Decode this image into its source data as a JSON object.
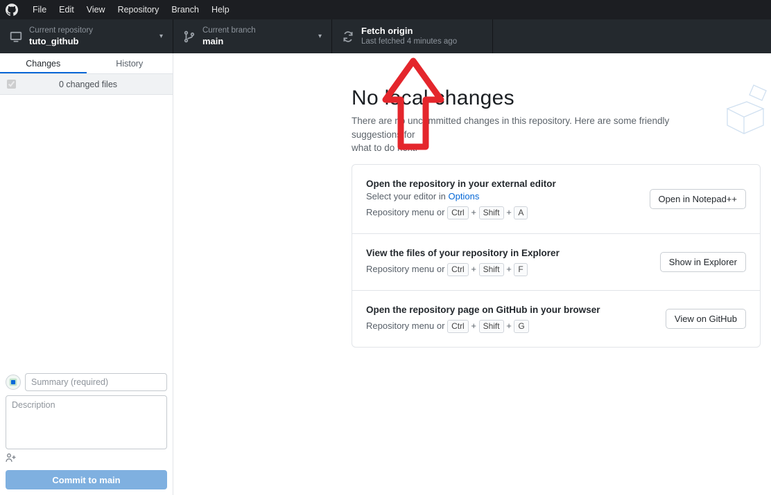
{
  "menubar": {
    "items": [
      "File",
      "Edit",
      "View",
      "Repository",
      "Branch",
      "Help"
    ]
  },
  "toolbar": {
    "repo": {
      "label": "Current repository",
      "value": "tuto_github"
    },
    "branch": {
      "label": "Current branch",
      "value": "main"
    },
    "fetch": {
      "label": "Fetch origin",
      "value": "Last fetched 4 minutes ago"
    }
  },
  "sidebar": {
    "tabs": {
      "changes": "Changes",
      "history": "History"
    },
    "changes_count_label": "0 changed files",
    "summary_placeholder": "Summary (required)",
    "description_placeholder": "Description",
    "commit_btn_prefix": "Commit to ",
    "commit_btn_branch": "main"
  },
  "main": {
    "title": "No local changes",
    "subtitle_a": "There are no uncommitted changes in this repository. Here are some friendly suggestions for",
    "subtitle_b": "what to do next.",
    "cards": [
      {
        "title": "Open the repository in your external editor",
        "sub_prefix": "Select your editor in ",
        "sub_link": "Options",
        "hint_prefix": "Repository menu or ",
        "keys": [
          "Ctrl",
          "Shift",
          "A"
        ],
        "button": "Open in Notepad++"
      },
      {
        "title": "View the files of your repository in Explorer",
        "sub_prefix": "",
        "sub_link": "",
        "hint_prefix": "Repository menu or ",
        "keys": [
          "Ctrl",
          "Shift",
          "F"
        ],
        "button": "Show in Explorer"
      },
      {
        "title": "Open the repository page on GitHub in your browser",
        "sub_prefix": "",
        "sub_link": "",
        "hint_prefix": "Repository menu or ",
        "keys": [
          "Ctrl",
          "Shift",
          "G"
        ],
        "button": "View on GitHub"
      }
    ]
  }
}
